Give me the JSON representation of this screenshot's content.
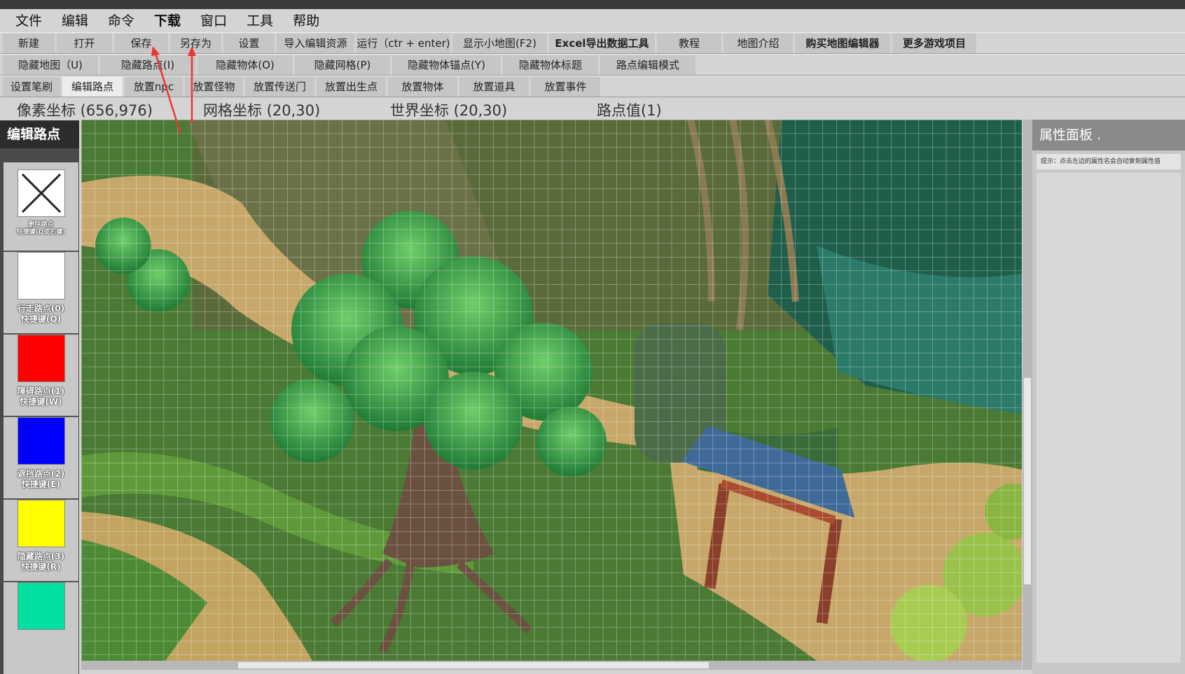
{
  "menu": {
    "items": [
      {
        "label": "文件",
        "bold": false
      },
      {
        "label": "编辑",
        "bold": false
      },
      {
        "label": "命令",
        "bold": false
      },
      {
        "label": "下载",
        "bold": true
      },
      {
        "label": "窗口",
        "bold": false
      },
      {
        "label": "工具",
        "bold": false
      },
      {
        "label": "帮助",
        "bold": false
      }
    ]
  },
  "toolbar1": [
    {
      "label": "新建"
    },
    {
      "label": "打开"
    },
    {
      "label": "保存"
    },
    {
      "label": "另存为"
    },
    {
      "label": "设置"
    },
    {
      "label": "导入编辑资源"
    },
    {
      "label": "运行（ctr + enter)"
    },
    {
      "label": "显示小地图(F2)"
    },
    {
      "label": "Excel导出数据工具",
      "bold": true
    },
    {
      "label": "教程"
    },
    {
      "label": "地图介绍"
    },
    {
      "label": "购买地图编辑器",
      "bold": true
    },
    {
      "label": "更多游戏项目",
      "bold": true
    }
  ],
  "toolbar2": [
    {
      "label": "隐藏地图（U)"
    },
    {
      "label": "隐藏路点(I)"
    },
    {
      "label": "隐藏物体(O)"
    },
    {
      "label": "隐藏网格(P)"
    },
    {
      "label": "隐藏物体锚点(Y)"
    },
    {
      "label": "隐藏物体标题"
    },
    {
      "label": "路点编辑模式"
    }
  ],
  "toolbar3": [
    {
      "label": "设置笔刷"
    },
    {
      "label": "编辑路点",
      "active": true
    },
    {
      "label": "放置npc"
    },
    {
      "label": "放置怪物"
    },
    {
      "label": "放置传送门"
    },
    {
      "label": "放置出生点"
    },
    {
      "label": "放置物体"
    },
    {
      "label": "放置道具"
    },
    {
      "label": "放置事件"
    }
  ],
  "coords": {
    "pixel": "像素坐标 (656,976)",
    "grid": "网格坐标 (20,30)",
    "world": "世界坐标 (20,30)",
    "waypoint": "路点值(1)"
  },
  "left_panel": {
    "title": "编辑路点",
    "tools": [
      {
        "name": "delete",
        "color": "#ffffff",
        "icon": "cross-icon",
        "line1": "删除路点",
        "line2": "快捷键(D或右键)",
        "small": true
      },
      {
        "name": "walk",
        "color": "#ffffff",
        "line1": "行走路点(0)",
        "line2": "快捷键(Q)"
      },
      {
        "name": "obstacle",
        "color": "#ff0000",
        "line1": "障碍路点(1)",
        "line2": "快捷键(W)"
      },
      {
        "name": "cover",
        "color": "#0000ff",
        "line1": "遮挡路点(2)",
        "line2": "快捷键(E)"
      },
      {
        "name": "hidden",
        "color": "#ffff00",
        "line1": "隐藏路点(3)",
        "line2": "快捷键(R)"
      },
      {
        "name": "extra",
        "color": "#00e0a0",
        "line1": "",
        "line2": ""
      }
    ]
  },
  "right_panel": {
    "title": "属性面板 .",
    "hint": "提示：点击左边的属性名会自动复制属性值"
  },
  "colors": {
    "arrow": "#ee3333",
    "grid": "#ffffff"
  }
}
